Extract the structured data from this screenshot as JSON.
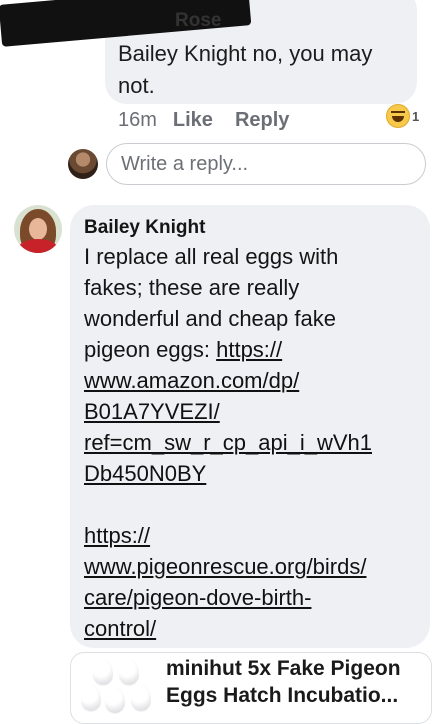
{
  "top_comment": {
    "author_partial": "Rose",
    "message_line1": "Bailey Knight no, you may",
    "message_line2": "not.",
    "time": "16m",
    "like_label": "Like",
    "reply_label": "Reply",
    "reaction_icon": "laugh-react-icon",
    "reaction_count": "1"
  },
  "reply_box": {
    "placeholder": "Write a reply..."
  },
  "bailey_comment": {
    "author": "Bailey Knight",
    "lines": [
      "I replace all real eggs with",
      "fakes; these are really",
      "wonderful and cheap fake",
      "pigeon eggs: "
    ],
    "link1_parts": [
      "https://",
      "www.amazon.com/dp/",
      "B01A7YVEZI/",
      "ref=cm_sw_r_cp_api_i_wVh1",
      "Db450N0BY"
    ],
    "link2_parts": [
      "https://",
      "www.pigeonrescue.org/birds/",
      "care/pigeon-dove-birth-",
      "control/"
    ]
  },
  "link_preview": {
    "title_line1": "minihut 5x Fake Pigeon",
    "title_line2": "Eggs Hatch Incubatio..."
  },
  "colors": {
    "bubble": "#eef0f3",
    "meta_text": "#6b6f75"
  }
}
